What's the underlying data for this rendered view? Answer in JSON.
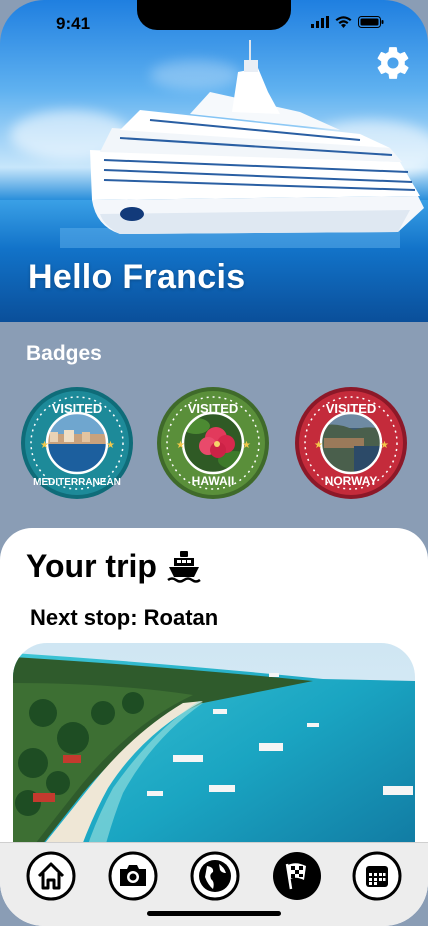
{
  "status_bar": {
    "time": "9:41"
  },
  "header": {
    "greeting": "Hello Francis"
  },
  "badges": {
    "title": "Badges",
    "items": [
      {
        "top_text": "VISITED",
        "bottom_text": "MEDITERRANEAN",
        "ring_color": "#1d8a99",
        "inner_color": "#146f7c"
      },
      {
        "top_text": "VISITED",
        "bottom_text": "HAWAII",
        "ring_color": "#5a8f3a",
        "inner_color": "#4a7a2e"
      },
      {
        "top_text": "VISITED",
        "bottom_text": "NORWAY",
        "ring_color": "#c42b3b",
        "inner_color": "#a81f2f"
      }
    ]
  },
  "trip": {
    "title": "Your trip",
    "next_stop": "Next stop: Roatan"
  },
  "tabbar": {
    "items": [
      "home-icon",
      "camera-icon",
      "globe-icon",
      "checkered-flag-icon",
      "calendar-icon"
    ]
  },
  "colors": {
    "badges_bg": "#8a9db5",
    "sheet_bg": "#ffffff",
    "tabbar_bg": "#ededed"
  }
}
